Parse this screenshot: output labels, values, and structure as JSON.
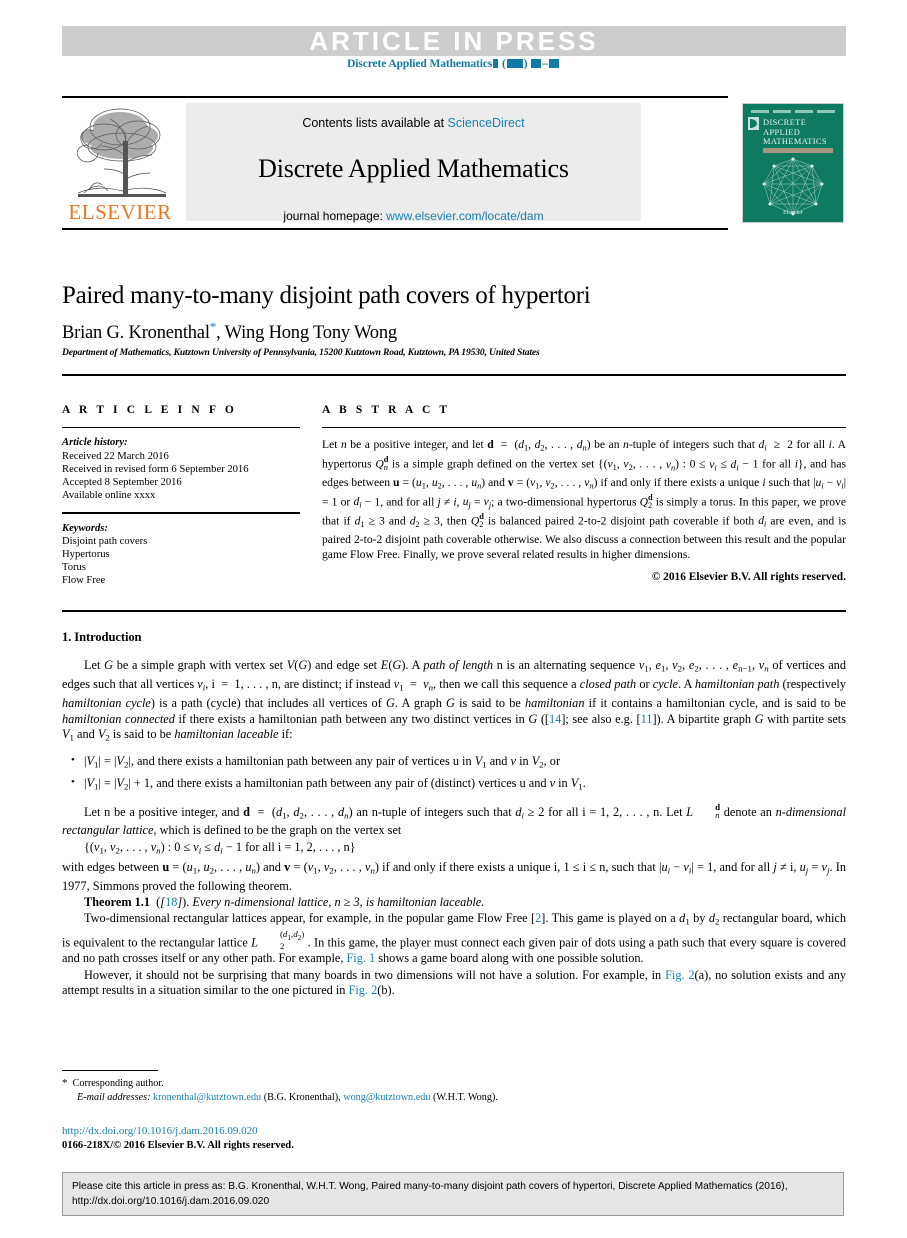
{
  "banner": {
    "article_in_press": "ARTICLE  IN  PRESS",
    "journal_ref_prefix": "Discrete Applied Mathematics"
  },
  "masthead": {
    "contents_prefix": "Contents lists available at ",
    "contents_link": "ScienceDirect",
    "journal_name": "Discrete Applied Mathematics",
    "homepage_prefix": "journal homepage: ",
    "homepage_link": "www.elsevier.com/locate/dam",
    "publisher_logo_text": "ELSEVIER",
    "cover": {
      "title_line1": "DISCRETE",
      "title_line2": "APPLIED",
      "title_line3": "MATHEMATICS",
      "bottom_text": "Elsevier"
    }
  },
  "article": {
    "title": "Paired many-to-many disjoint path covers of hypertori",
    "authors_part1": "Brian G. Kronenthal",
    "authors_star": "*",
    "authors_part2": ", Wing Hong Tony Wong",
    "affiliation": "Department of Mathematics, Kutztown University of Pennsylvania, 15200 Kutztown Road, Kutztown, PA 19530, United States"
  },
  "info": {
    "heading": "A R T I C L E    I N F O",
    "history_label": "Article history:",
    "history": [
      "Received 22 March 2016",
      "Received in revised form 6 September 2016",
      "Accepted 8 September 2016",
      "Available online xxxx"
    ],
    "keywords_label": "Keywords:",
    "keywords": [
      "Disjoint path covers",
      "Hypertorus",
      "Torus",
      "Flow Free"
    ]
  },
  "abstract": {
    "heading": "A B S T R A C T",
    "copyright": "© 2016 Elsevier B.V. All rights reserved."
  },
  "body": {
    "section1_heading": "1. Introduction",
    "theorem_label": "Theorem 1.1",
    "ref_18": "18",
    "ref_14": "14",
    "ref_11": "11",
    "ref_2": "2",
    "fig1": "Fig. 1",
    "fig2a": "Fig. 2",
    "fig2b": "Fig. 2"
  },
  "footnote": {
    "corresponding": "Corresponding author.",
    "email_label": "E-mail addresses:",
    "email1": "kronenthal@kutztown.edu",
    "email1_who": "(B.G. Kronenthal)",
    "email2": "wong@kutztown.edu",
    "email2_who": "(W.H.T. Wong).",
    "doi_url": "http://dx.doi.org/10.1016/j.dam.2016.09.020",
    "issn_line": "0166-218X/© 2016 Elsevier B.V. All rights reserved."
  },
  "cite_box": {
    "line1": "Please cite this article in press as: B.G. Kronenthal, W.H.T. Wong, Paired many-to-many disjoint path covers of hypertori, Discrete Applied Mathematics",
    "line2": "(2016), http://dx.doi.org/10.1016/j.dam.2016.09.020"
  },
  "colors": {
    "link": "#1a7fb0",
    "banner_bg": "#cdcdcd",
    "masthead_bg": "#ececec",
    "cover_green": "#0e7a5f",
    "elsevier_orange": "#e87722"
  }
}
